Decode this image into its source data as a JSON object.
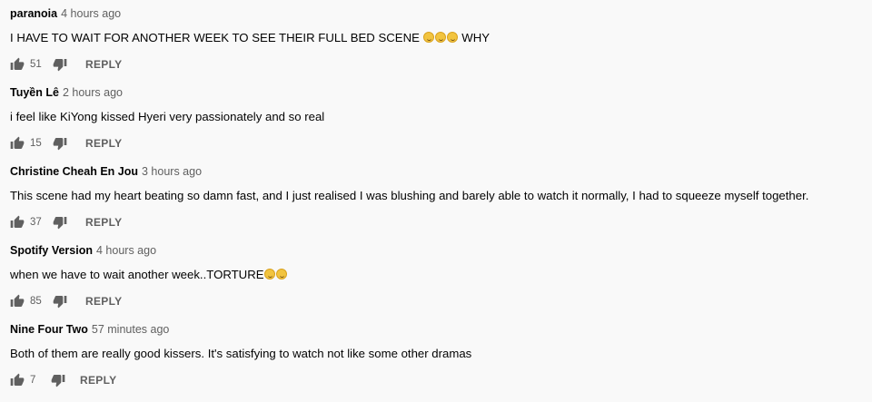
{
  "comments": [
    {
      "author": "paranoia",
      "time": "4 hours ago",
      "text": "I HAVE TO WAIT FOR ANOTHER WEEK TO SEE THEIR FULL BED SCENE",
      "text_suffix": "WHY",
      "emoji_count": 3,
      "likes": "51",
      "reply_label": "REPLY"
    },
    {
      "author": "Tuyền Lê",
      "time": "2 hours ago",
      "text": "i feel like KiYong kissed Hyeri very passionately and so real",
      "text_suffix": "",
      "emoji_count": 0,
      "likes": "15",
      "reply_label": "REPLY"
    },
    {
      "author": "Christine Cheah En Jou",
      "time": "3 hours ago",
      "text": "This scene had my heart beating so damn fast, and I just realised I was blushing and barely able to watch it normally, I had to squeeze myself together.",
      "text_suffix": "",
      "emoji_count": 0,
      "likes": "37",
      "reply_label": "REPLY"
    },
    {
      "author": "Spotify Version",
      "time": "4 hours ago",
      "text": "when we have to wait another week..TORTURE",
      "text_suffix": "",
      "emoji_count": 2,
      "likes": "85",
      "reply_label": "REPLY"
    },
    {
      "author": "Nine Four Two",
      "time": "57 minutes ago",
      "text": "Both of them are really good kissers. It's satisfying to watch not like some other dramas",
      "text_suffix": "",
      "emoji_count": 0,
      "likes": "7",
      "reply_label": "REPLY"
    }
  ]
}
